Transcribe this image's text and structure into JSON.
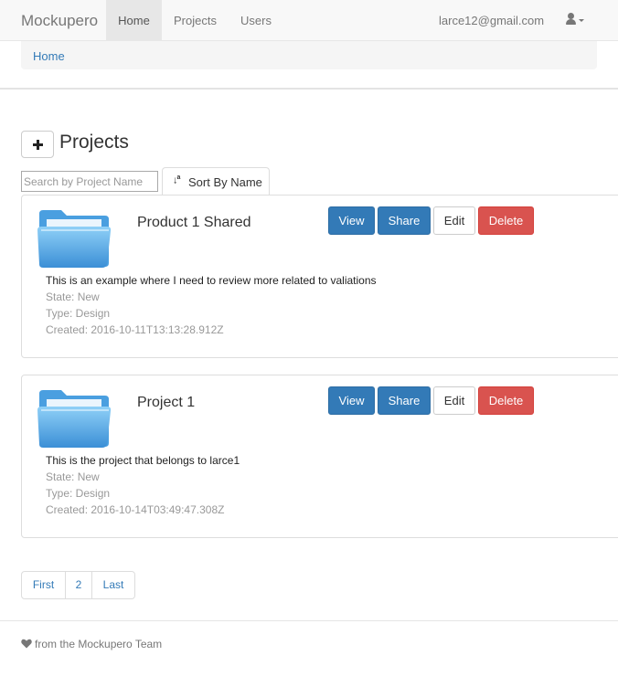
{
  "navbar": {
    "brand": "Mockupero",
    "items": [
      {
        "label": "Home",
        "active": true
      },
      {
        "label": "Projects",
        "active": false
      },
      {
        "label": "Users",
        "active": false
      }
    ],
    "user_email": "larce12@gmail.com",
    "user_icon": "user-icon"
  },
  "breadcrumb": {
    "items": [
      "Home"
    ]
  },
  "page": {
    "title": "Projects",
    "add_icon": "plus-icon",
    "search_placeholder": "Search by Project Name",
    "search_value": "",
    "sort_label": "Sort By Name",
    "sort_icon": "sort-alpha-icon"
  },
  "projects": [
    {
      "name": "Product 1 Shared",
      "description": "This is an example where I need to review more related to valiations",
      "state": "State: New",
      "type": "Type: Design",
      "created": "Created: 2016-10-11T13:13:28.912Z",
      "actions": {
        "view": "View",
        "share": "Share",
        "edit": "Edit",
        "delete": "Delete"
      }
    },
    {
      "name": "Project 1",
      "description": "This is the project that belongs to larce1",
      "state": "State: New",
      "type": "Type: Design",
      "created": "Created: 2016-10-14T03:49:47.308Z",
      "actions": {
        "view": "View",
        "share": "Share",
        "edit": "Edit",
        "delete": "Delete"
      }
    }
  ],
  "pagination": {
    "first": "First",
    "page": "2",
    "last": "Last"
  },
  "footer": {
    "text": "from the Mockupero Team",
    "icon": "heart-icon"
  },
  "colors": {
    "primary": "#337ab7",
    "danger": "#d9534f",
    "navbar_bg": "#f8f8f8",
    "folder": "#5aaee8"
  }
}
